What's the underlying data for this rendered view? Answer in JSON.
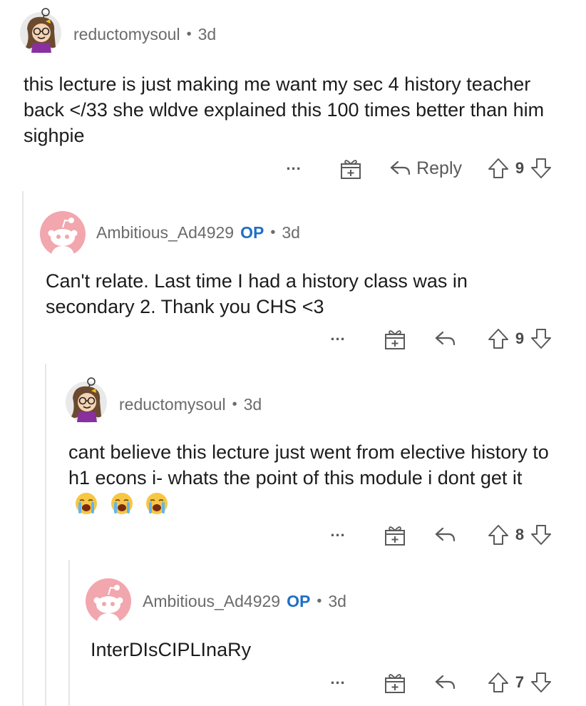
{
  "comments": [
    {
      "username": "reductomysoul",
      "age": "3d",
      "body": "this lecture is just making me want my sec 4 history teacher back </33 she wldve explained this 100 times better than him sighpie",
      "score": "9",
      "reply_label": "Reply",
      "more": "...",
      "avatar": "cartoon-girl-avatar"
    },
    {
      "username": "Ambitious_Ad4929",
      "op_badge": "OP",
      "age": "3d",
      "body": "Can't relate. Last time I had a history class was in secondary 2. Thank you CHS <3",
      "score": "9",
      "more": "...",
      "avatar": "default-snoo-avatar"
    },
    {
      "username": "reductomysoul",
      "age": "3d",
      "body": "cant believe this lecture just went from elective history to h1 econs i- whats the point of this module i dont get it",
      "score": "8",
      "more": "...",
      "avatar": "cartoon-girl-avatar",
      "emojis": [
        "crying-face-emoji",
        "crying-face-emoji",
        "crying-face-emoji"
      ]
    },
    {
      "username": "Ambitious_Ad4929",
      "op_badge": "OP",
      "age": "3d",
      "body": "InterDIsCIPLInaRy",
      "score": "7",
      "more": "...",
      "avatar": "default-snoo-avatar"
    }
  ],
  "dot": "•",
  "colors": {
    "op": "#1f6fc5",
    "meta": "#6b6b6b",
    "text": "#1c1c1c",
    "thread_line": "#e6e6e6",
    "snoo_bg": "#f2a6ad"
  }
}
